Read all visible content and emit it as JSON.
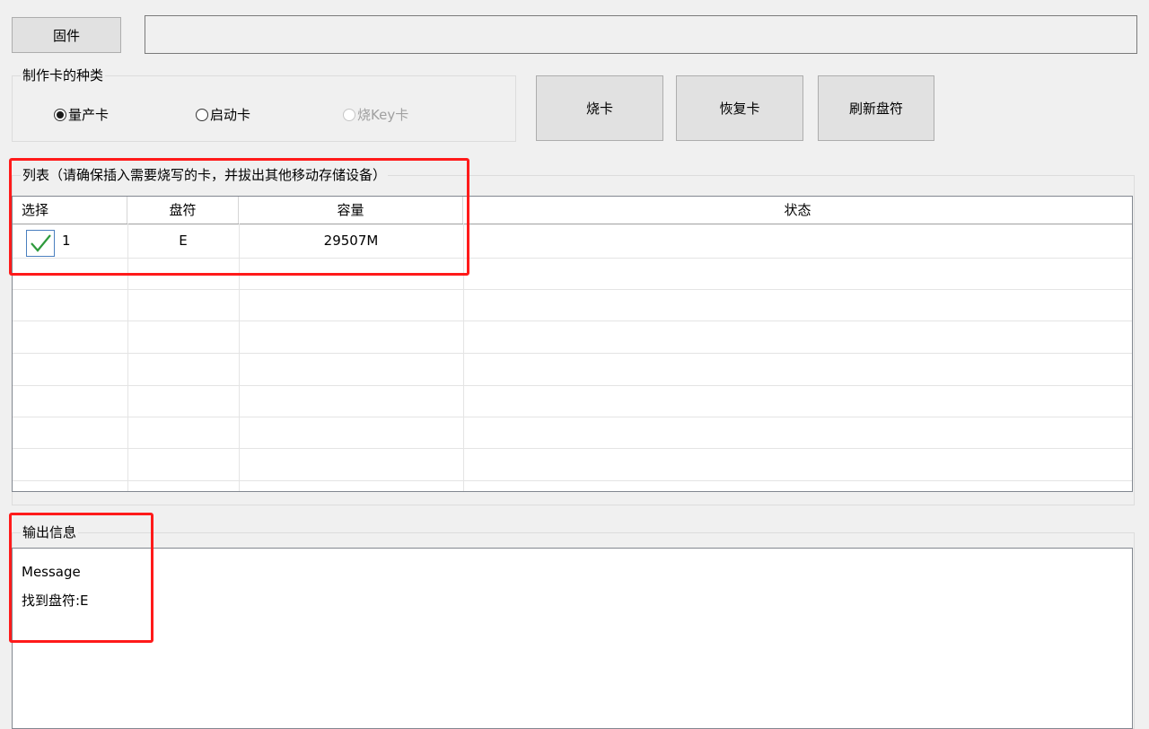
{
  "toolbar": {
    "firmware_label": "固件",
    "firmware_path": ""
  },
  "card_type": {
    "title": "制作卡的种类",
    "options": [
      {
        "label": "量产卡",
        "selected": true,
        "enabled": true
      },
      {
        "label": "启动卡",
        "selected": false,
        "enabled": true
      },
      {
        "label": "烧Key卡",
        "selected": false,
        "enabled": false
      }
    ]
  },
  "actions": {
    "burn_label": "烧卡",
    "restore_label": "恢复卡",
    "refresh_label": "刷新盘符"
  },
  "list": {
    "title": "列表（请确保插入需要烧写的卡，并拔出其他移动存储设备）",
    "columns": [
      "选择",
      "盘符",
      "容量",
      "状态"
    ],
    "rows": [
      {
        "checked": true,
        "index": "1",
        "drive": "E",
        "capacity": "29507M",
        "status": ""
      }
    ]
  },
  "output": {
    "title": "输出信息",
    "lines": [
      "Message",
      "找到盘符:E"
    ]
  },
  "colors": {
    "highlight": "#ff1a1a",
    "check": "#2e9a3c"
  }
}
